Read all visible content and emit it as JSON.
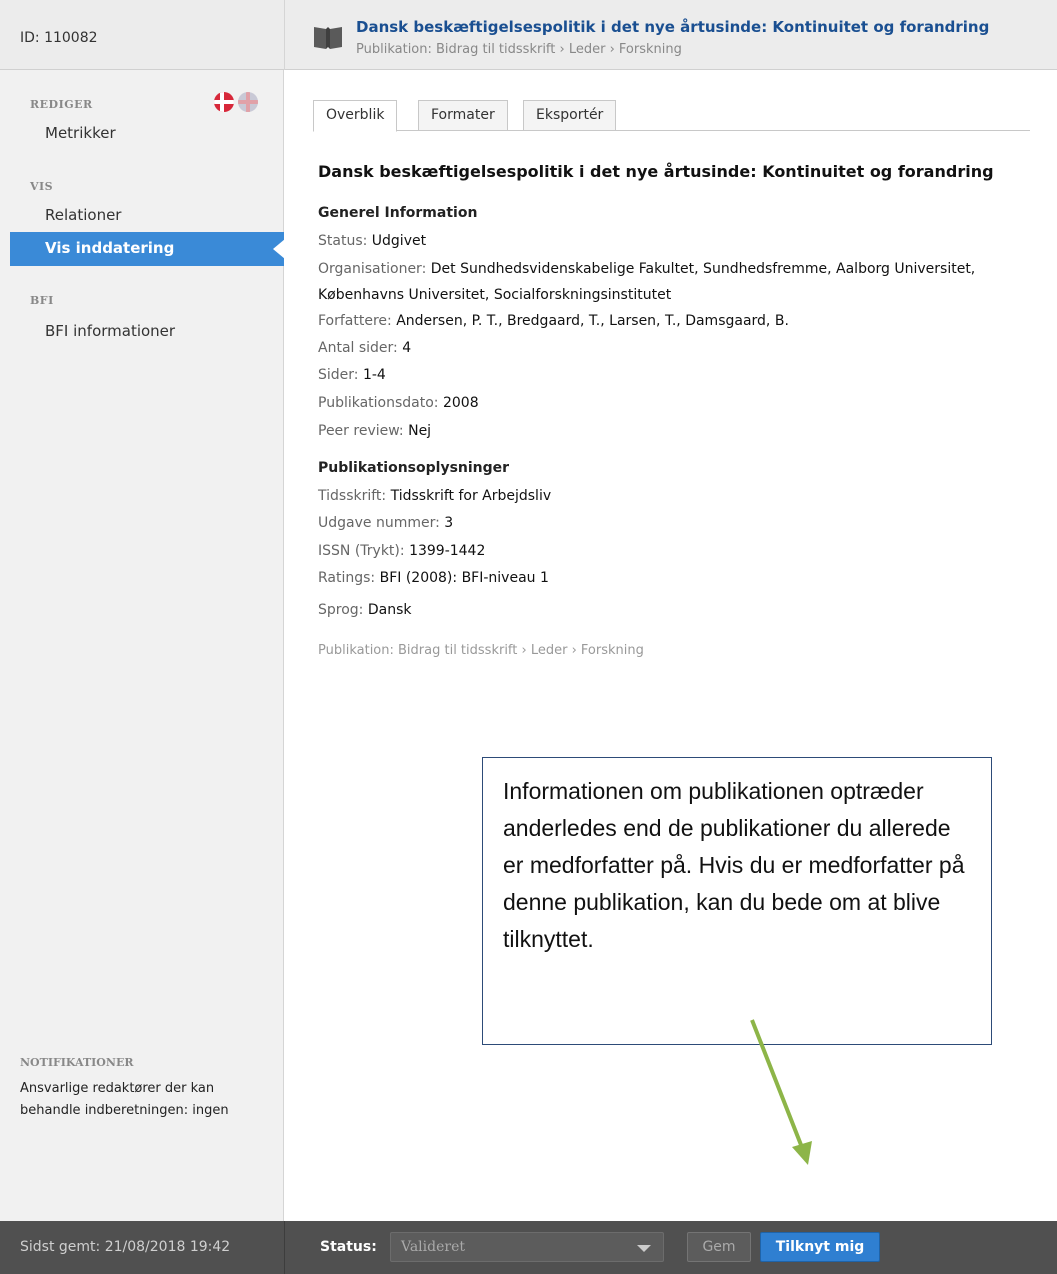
{
  "header": {
    "id_label": "ID: 110082",
    "title": "Dansk beskæftigelsespolitik i det nye årtusinde: Kontinuitet og forandring",
    "breadcrumb": "Publikation: Bidrag til tidsskrift › Leder › Forskning",
    "icon": "book-icon"
  },
  "sidebar": {
    "section_rediger": "REDIGER",
    "item_metrikker": "Metrikker",
    "section_vis": "VIS",
    "item_relationer": "Relationer",
    "item_vis_inddatering": "Vis inddatering",
    "section_bfi": "BFI",
    "item_bfi_informationer": "BFI informationer",
    "notifications_title": "NOTIFIKATIONER",
    "notifications_text": "Ansvarlige redaktører der kan behandle indberetningen: ingen",
    "active_color": "#3a8ad7"
  },
  "tabs": [
    "Overblik",
    "Formater",
    "Eksportér"
  ],
  "content": {
    "title": "Dansk beskæftigelsespolitik i det nye årtusinde: Kontinuitet og forandring",
    "general_heading": "Generel Information",
    "status_k": "Status:",
    "status_v": "Udgivet",
    "org_k": "Organisationer:",
    "org_v": "Det Sundhedsvidenskabelige Fakultet, Sundhedsfremme, Aalborg Universitet, Københavns Universitet, Socialforskningsinstitutet",
    "authors_k": "Forfattere:",
    "authors_v": "Andersen, P. T., Bredgaard, T., Larsen, T., Damsgaard, B.",
    "pages_count_k": "Antal sider:",
    "pages_count_v": "4",
    "pages_k": "Sider:",
    "pages_v": "1-4",
    "date_k": "Publikationsdato:",
    "date_v": "2008",
    "peer_k": "Peer review:",
    "peer_v": "Nej",
    "pub_heading": "Publikationsoplysninger",
    "journal_k": "Tidsskrift:",
    "journal_v": "Tidsskrift for Arbejdsliv",
    "issue_k": "Udgave nummer:",
    "issue_v": "3",
    "issn_k": "ISSN (Trykt):",
    "issn_v": "1399-1442",
    "ratings_k": "Ratings:",
    "ratings_v": "BFI (2008): BFI-niveau 1",
    "lang_k": "Sprog:",
    "lang_v": "Dansk",
    "footer_crumb": "Publikation: Bidrag til tidsskrift › Leder › Forskning"
  },
  "callout": {
    "text": "Informationen om publikationen optræder anderledes end de publikationer du allerede er medforfatter på. Hvis du er medforfatter på denne publikation, kan du bede om at blive tilknyttet.",
    "border_color": "#2d4b78",
    "arrow_color": "#8db548"
  },
  "bottombar": {
    "saved": "Sidst gemt: 21/08/2018 19:42",
    "status_label": "Status:",
    "status_value": "Valideret",
    "gem_label": "Gem",
    "tilknyt_label": "Tilknyt mig"
  }
}
